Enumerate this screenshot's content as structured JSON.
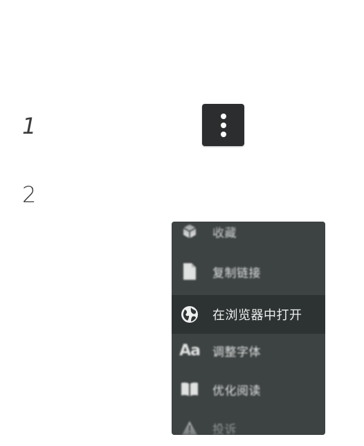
{
  "steps": {
    "step1": "1",
    "step2": "2"
  },
  "more_button": {
    "icon": "more-vertical-icon"
  },
  "menu": {
    "items": [
      {
        "label": "收藏",
        "icon": "favorite-box-icon",
        "blurred": true
      },
      {
        "label": "复制链接",
        "icon": "copy-document-icon",
        "blurred": true
      },
      {
        "label": "在浏览器中打开",
        "icon": "globe-icon",
        "blurred": false,
        "highlighted": true
      },
      {
        "label": "调整字体",
        "icon": "font-aa-icon",
        "blurred": true
      },
      {
        "label": "优化阅读",
        "icon": "book-icon",
        "blurred": true
      },
      {
        "label": "投诉",
        "icon": "warning-icon",
        "blurred": true
      }
    ]
  },
  "colors": {
    "menu_background": "#3d4242",
    "menu_highlight": "#2d3232",
    "button_background": "#2c2d2f",
    "text_light": "#eef0ef"
  }
}
